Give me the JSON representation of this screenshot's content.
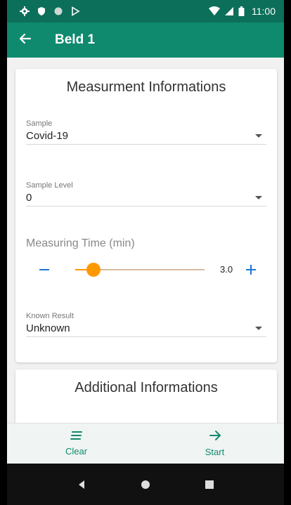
{
  "status_bar": {
    "time": "11:00"
  },
  "app_bar": {
    "title": "Beld 1"
  },
  "measurement_card": {
    "title": "Measurment Informations",
    "sample": {
      "label": "Sample",
      "value": "Covid-19"
    },
    "sample_level": {
      "label": "Sample Level",
      "value": "0"
    },
    "measuring_time": {
      "label": "Measuring Time (min)",
      "value": "3.0",
      "fill_fraction": 0.14
    },
    "known_result": {
      "label": "Known Result",
      "value": "Unknown"
    }
  },
  "additional_card": {
    "title": "Additional Informations"
  },
  "bottom_nav": {
    "clear_label": "Clear",
    "start_label": "Start"
  },
  "colors": {
    "status_bar": "#0c6f5a",
    "app_bar": "#0f8a6e",
    "slider_accent": "#ff9800",
    "stepper_blue": "#1976d2"
  },
  "icons": {
    "status": [
      "gear-icon",
      "shield-icon",
      "circle-icon",
      "play-store-icon",
      "wifi-icon",
      "signal-icon",
      "battery-icon"
    ],
    "back": "arrow-left-icon",
    "clear": "lines-icon",
    "start": "arrow-right-icon"
  }
}
